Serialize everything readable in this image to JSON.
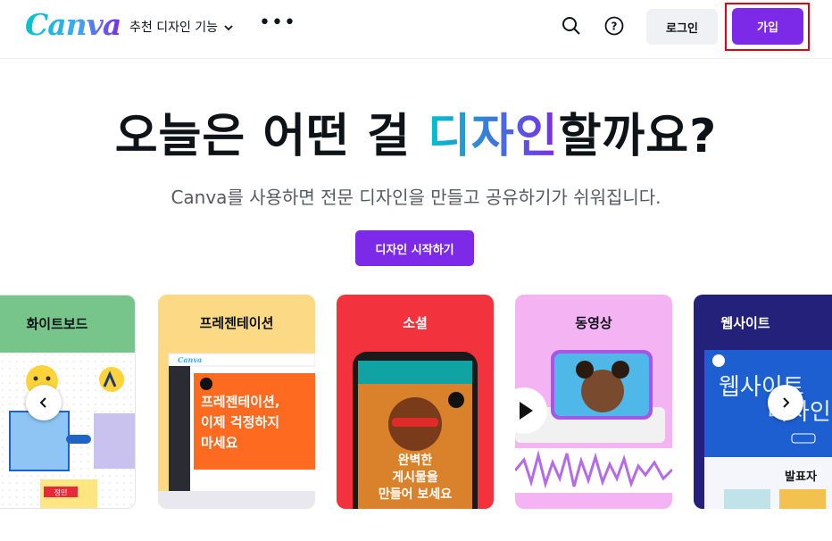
{
  "header": {
    "logo": "Canva",
    "features_menu": "추천 디자인 기능",
    "more": "•••",
    "login": "로그인",
    "signup": "가입"
  },
  "hero": {
    "title_before": "오늘은 어떤 걸 ",
    "title_highlight": "디자인",
    "title_after": "할까요?",
    "subtitle": "Canva를 사용하면 전문 디자인을 만들고 공유하기가 쉬워집니다.",
    "cta": "디자인 시작하기"
  },
  "cards": [
    {
      "title": "화이트보드",
      "sticky": "정민"
    },
    {
      "title": "프레젠테이션",
      "mini_logo": "Canva",
      "headline": "프레젠테이션, 이제 걱정하지 마세요"
    },
    {
      "title": "소셜",
      "headline": "완벽한 게시물을 만들어 보세요"
    },
    {
      "title": "동영상"
    },
    {
      "title": "웹사이트",
      "headline": "웹사이트 디자인",
      "section": "발표자"
    }
  ],
  "colors": {
    "brand_purple": "#7d2ae8",
    "whiteboard_header": "#77c58a",
    "presentation_bg": "#fcd985",
    "social_bg": "#f2333d",
    "video_bg": "#f4b4f3",
    "website_bg": "#23217a"
  }
}
